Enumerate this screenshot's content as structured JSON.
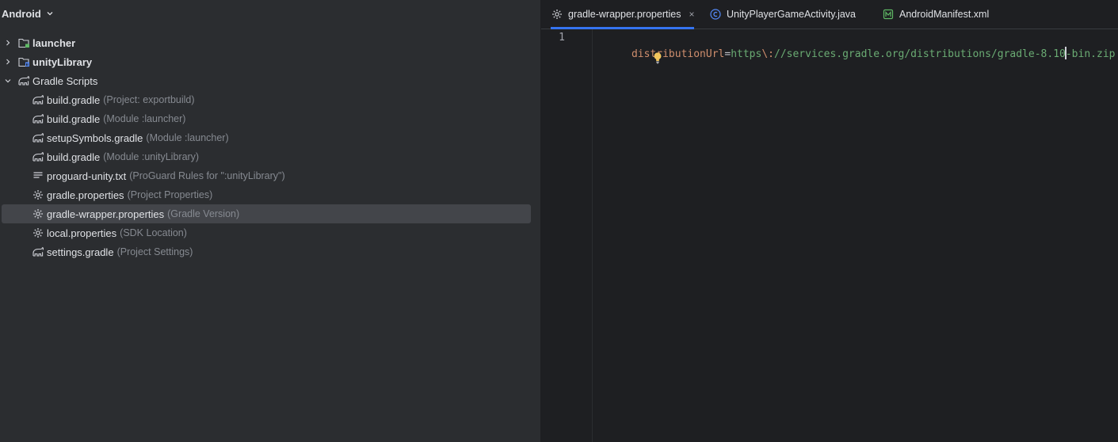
{
  "project_view": {
    "mode": "Android",
    "tree": [
      {
        "name": "launcher",
        "hint": "",
        "icon": "module-folder-icon",
        "bold": true,
        "expander": "collapsed"
      },
      {
        "name": "unityLibrary",
        "hint": "",
        "icon": "library-module-icon",
        "bold": true,
        "expander": "collapsed"
      },
      {
        "name": "Gradle Scripts",
        "hint": "",
        "icon": "gradle-elephant-icon",
        "bold": false,
        "expander": "expanded"
      },
      {
        "name": "build.gradle",
        "hint": "(Project: exportbuild)",
        "icon": "gradle-elephant-icon"
      },
      {
        "name": "build.gradle",
        "hint": "(Module :launcher)",
        "icon": "gradle-elephant-icon"
      },
      {
        "name": "setupSymbols.gradle",
        "hint": "(Module :launcher)",
        "icon": "gradle-elephant-icon"
      },
      {
        "name": "build.gradle",
        "hint": "(Module :unityLibrary)",
        "icon": "gradle-elephant-icon"
      },
      {
        "name": "proguard-unity.txt",
        "hint": "(ProGuard Rules for \":unityLibrary\")",
        "icon": "text-file-icon"
      },
      {
        "name": "gradle.properties",
        "hint": "(Project Properties)",
        "icon": "gear-icon"
      },
      {
        "name": "gradle-wrapper.properties",
        "hint": "(Gradle Version)",
        "icon": "gear-icon",
        "selected": true
      },
      {
        "name": "local.properties",
        "hint": "(SDK Location)",
        "icon": "gear-icon"
      },
      {
        "name": "settings.gradle",
        "hint": "(Project Settings)",
        "icon": "gradle-elephant-icon"
      }
    ]
  },
  "editor": {
    "tabs": [
      {
        "label": "gradle-wrapper.properties",
        "icon": "gear-icon",
        "active": true,
        "close": "×"
      },
      {
        "label": "UnityPlayerGameActivity.java",
        "icon": "java-class-icon",
        "active": false
      },
      {
        "label": "AndroidManifest.xml",
        "icon": "manifest-icon",
        "active": false
      }
    ],
    "line_numbers": [
      "1"
    ],
    "code": {
      "key": "distributionUrl",
      "equals": "=",
      "value_part1": "https",
      "escape": "\\:",
      "value_part2": "//services.gradle.org/distributions/gradle-8.10",
      "value_part3": "-bin.zip"
    },
    "intention_bulb": "lightbulb-icon"
  },
  "colors": {
    "panel_bg": "#2b2d30",
    "editor_bg": "#1e1f22",
    "selection": "#43454a",
    "active_tab_underline": "#3574f0",
    "property_key": "#cf8e6d",
    "property_value": "#6aab73",
    "hint_text": "#868a91"
  }
}
